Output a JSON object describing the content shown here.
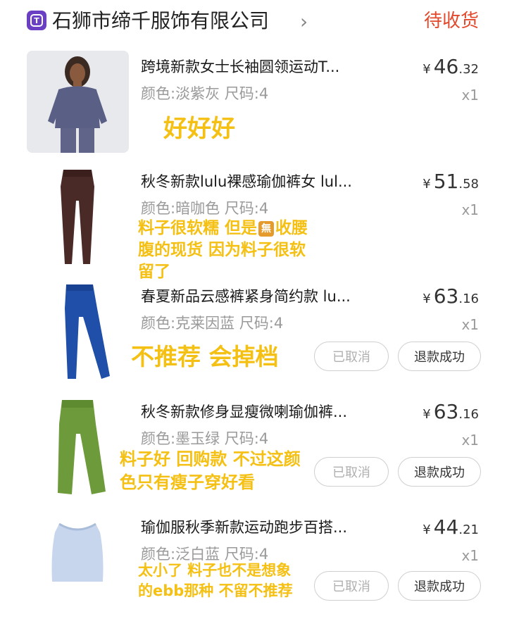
{
  "header": {
    "shop_name": "石狮市缔千服饰有限公司",
    "chevron": "›",
    "status": "待收货",
    "logo_letter": "T"
  },
  "items": [
    {
      "title": "跨境新款女士长袖圆领运动T...",
      "spec": "颜色:淡紫灰 尺码:4",
      "price_currency": "¥",
      "price_int": "46",
      "price_dec": ".32",
      "qty": "x1",
      "note_lines": [
        "好好好"
      ]
    },
    {
      "title": "秋冬新款lulu裸感瑜伽裤女 lul...",
      "spec": "颜色:暗咖色 尺码:4",
      "price_currency": "¥",
      "price_int": "51",
      "price_dec": ".58",
      "qty": "x1",
      "note_lines": [
        "料子很软糯 但是",
        "收腰",
        "腹的现货 因为料子很软",
        "留了"
      ],
      "note_badge": "無"
    },
    {
      "title": "春夏新品云感裤紧身简约款 lu...",
      "spec": "颜色:克莱因蓝 尺码:4",
      "price_currency": "¥",
      "price_int": "63",
      "price_dec": ".16",
      "qty": "x1",
      "note_lines": [
        "不推荐 会掉档"
      ],
      "btn_cancelled": "已取消",
      "btn_refund": "退款成功"
    },
    {
      "title": "秋冬新款修身显瘦微喇瑜伽裤...",
      "spec": "颜色:墨玉绿 尺码:4",
      "price_currency": "¥",
      "price_int": "63",
      "price_dec": ".16",
      "qty": "x1",
      "note_lines": [
        "料子好 回购款 不过这颜",
        "色只有瘦子穿好看"
      ],
      "btn_cancelled": "已取消",
      "btn_refund": "退款成功"
    },
    {
      "title": "瑜伽服秋季新款运动跑步百搭...",
      "spec": "颜色:泛白蓝 尺码:4",
      "price_currency": "¥",
      "price_int": "44",
      "price_dec": ".21",
      "qty": "x1",
      "note_lines": [
        "太小了 料子也不是想象",
        "的ebb那种 不留不推荐"
      ],
      "btn_cancelled": "已取消",
      "btn_refund": "退款成功"
    }
  ],
  "colors": {
    "status": "#e2492c",
    "note": "#f5c014",
    "logo": "#6b3fc4"
  }
}
